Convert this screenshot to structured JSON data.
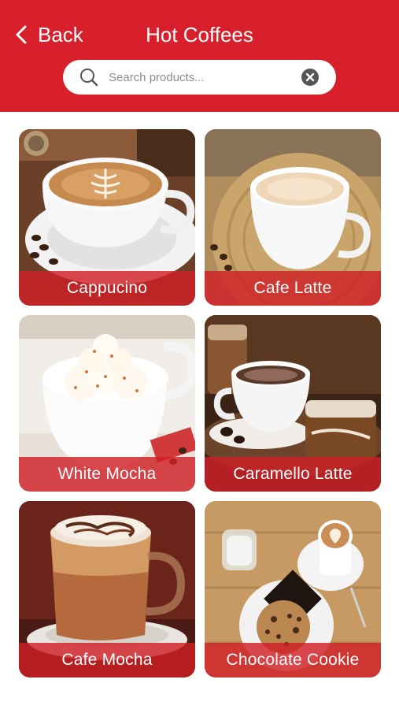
{
  "header": {
    "back_label": "Back",
    "title": "Hot Coffees",
    "background": "#d8202c"
  },
  "search": {
    "placeholder": "Search products...",
    "value": ""
  },
  "products": [
    {
      "name": "Cappucino",
      "image": "cappuccino-latte-art"
    },
    {
      "name": "Cafe Latte",
      "image": "cafe-latte-cup"
    },
    {
      "name": "White Mocha",
      "image": "white-mocha-whipped-cream"
    },
    {
      "name": "Caramello Latte",
      "image": "caramel-latte-glasses"
    },
    {
      "name": "Cafe Mocha",
      "image": "cafe-mocha-glass"
    },
    {
      "name": "Chocolate Cookie",
      "image": "chocolate-cookie-plate"
    }
  ],
  "colors": {
    "accent": "#d8202c",
    "label_bar": "#d02026"
  }
}
